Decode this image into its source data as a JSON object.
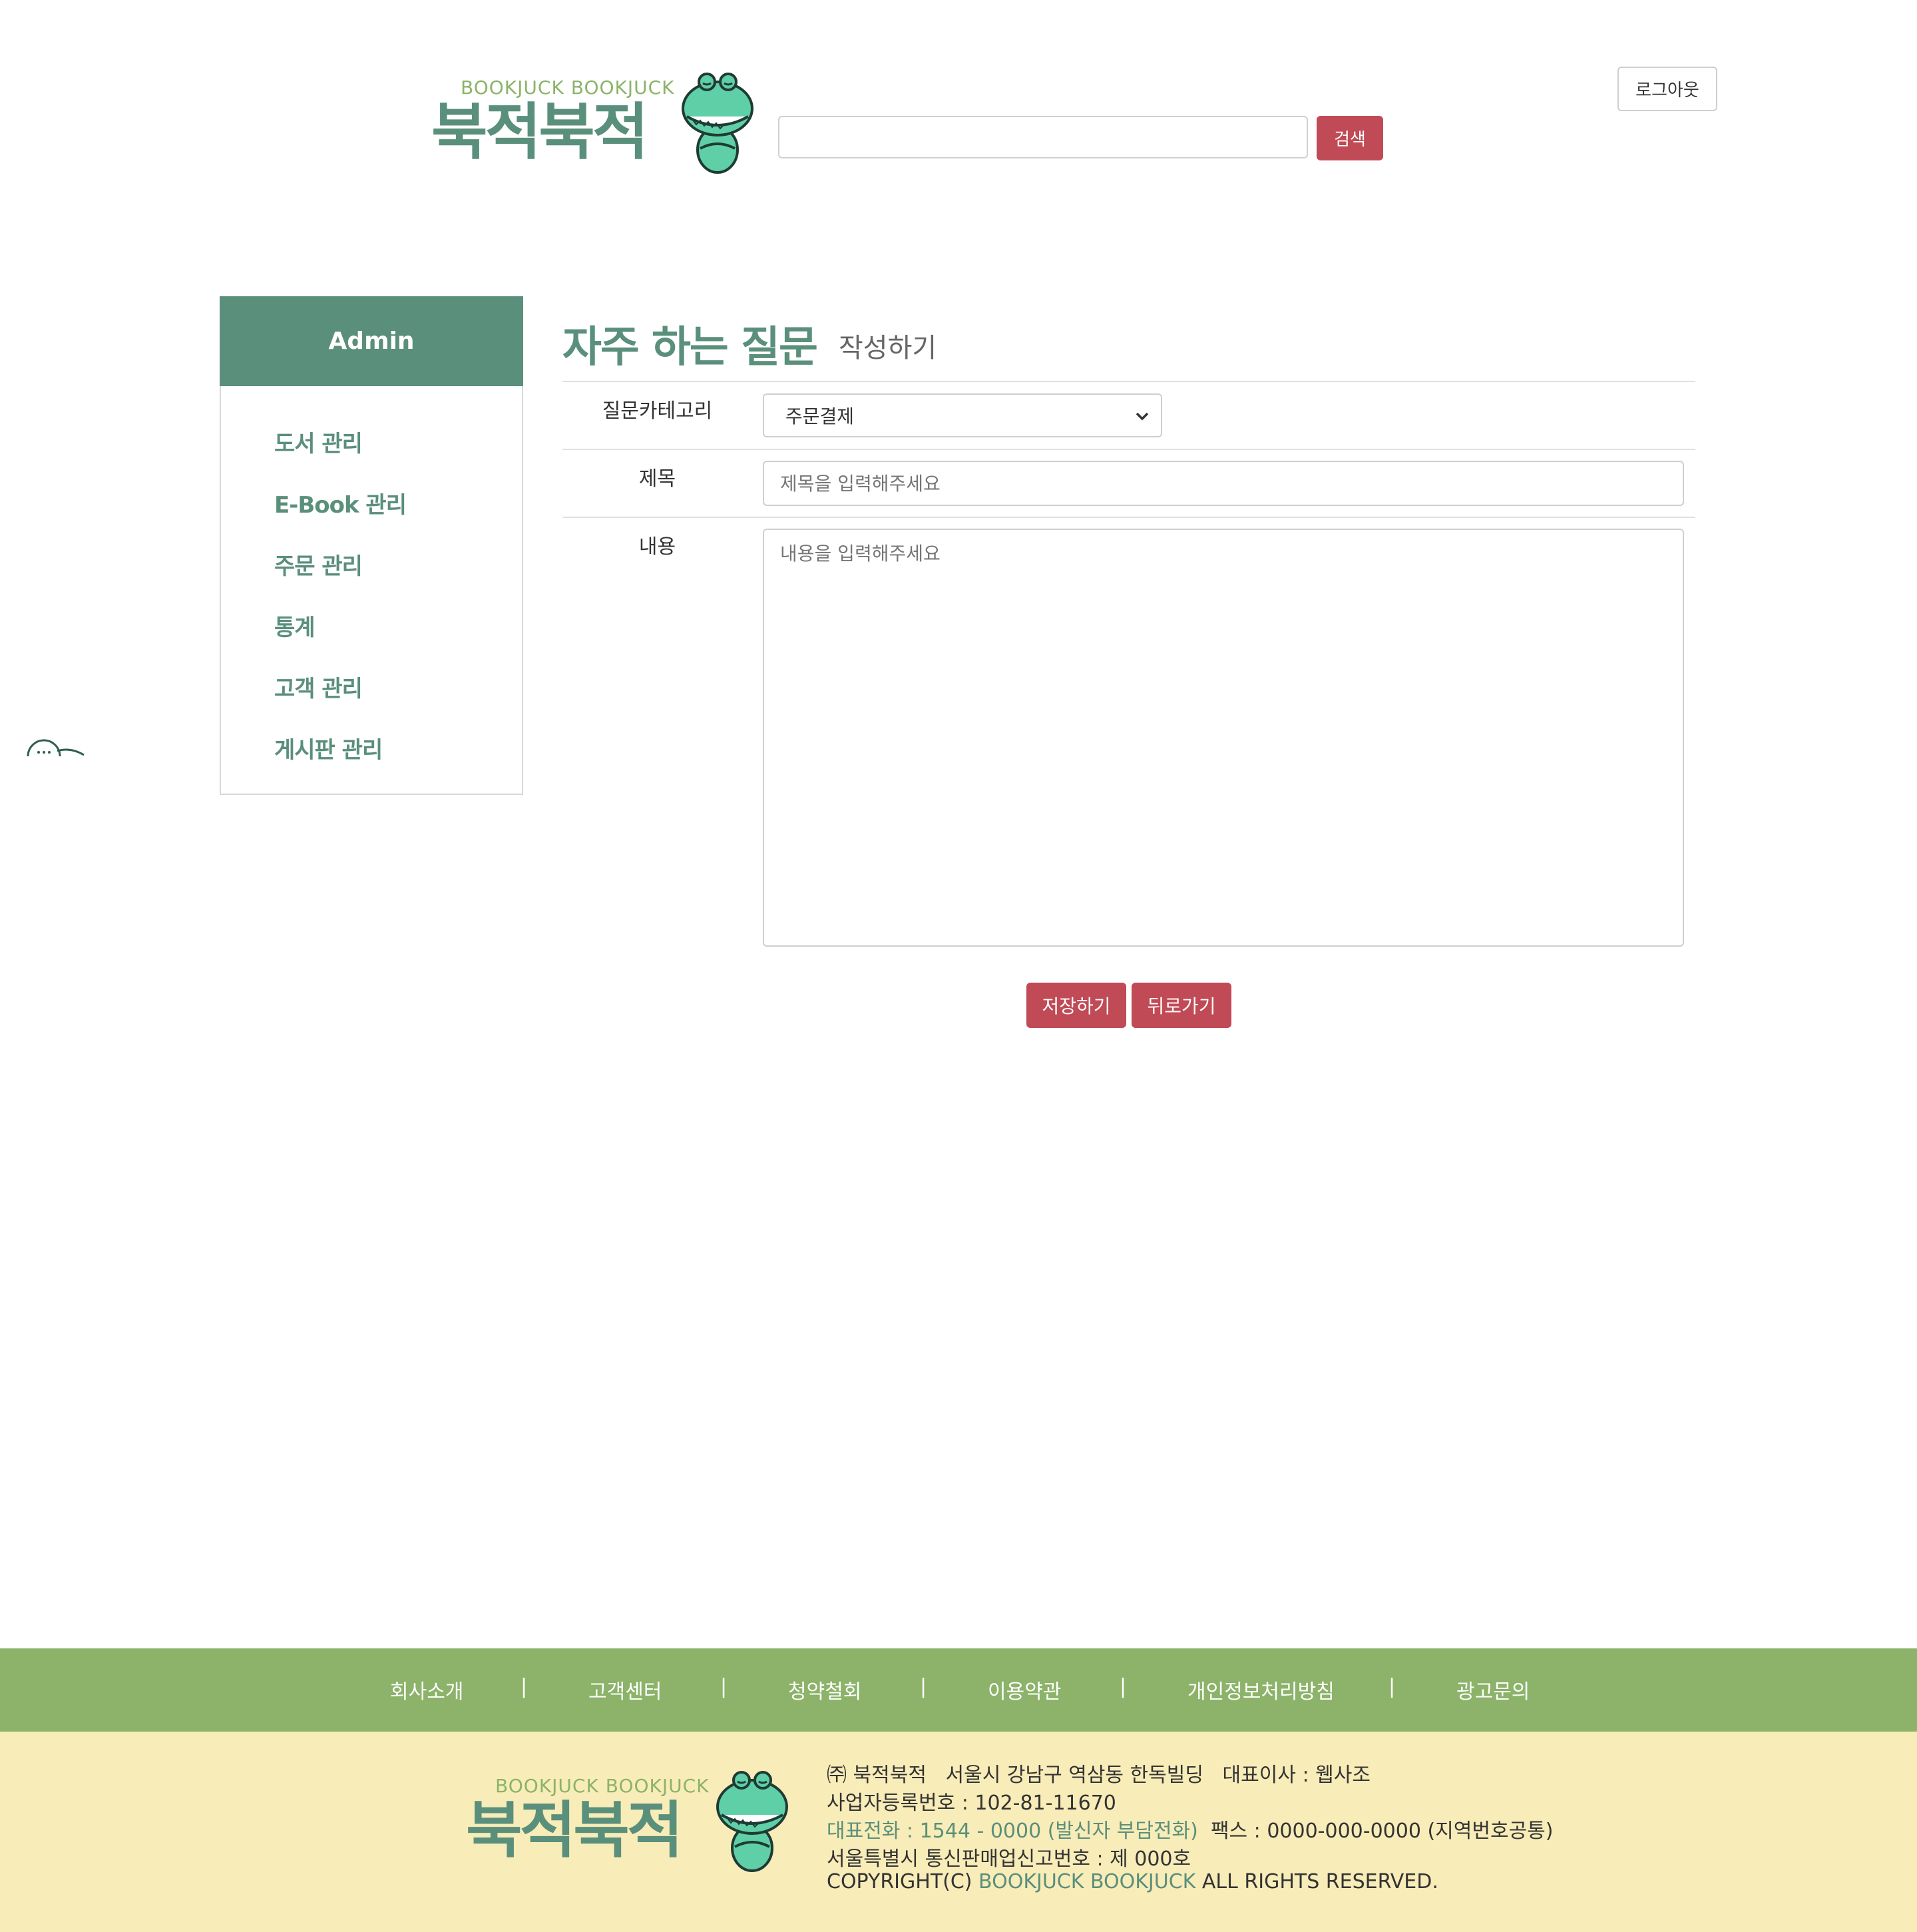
{
  "header": {
    "logo_sub": "BOOKJUCK BOOKJUCK",
    "logo_main": "북적북적",
    "search_value": "",
    "search_button": "검색",
    "logout_button": "로그아웃"
  },
  "sidebar": {
    "title": "Admin",
    "items": [
      {
        "label": "도서 관리"
      },
      {
        "label": "E-Book 관리"
      },
      {
        "label": "주문 관리"
      },
      {
        "label": "통계"
      },
      {
        "label": "고객 관리"
      },
      {
        "label": "게시판 관리"
      }
    ]
  },
  "main": {
    "title": "자주 하는 질문",
    "subtitle": "작성하기",
    "category_label": "질문카테고리",
    "category_selected": "주문결제",
    "title_label": "제목",
    "title_placeholder": "제목을 입력해주세요",
    "content_label": "내용",
    "content_placeholder": "내용을 입력해주세요",
    "save_button": "저장하기",
    "back_button": "뒤로가기"
  },
  "footer": {
    "links": [
      "회사소개",
      "고객센터",
      "청약철회",
      "이용약관",
      "개인정보처리방침",
      "광고문의"
    ],
    "separator": "|",
    "logo_sub": "BOOKJUCK BOOKJUCK",
    "logo_main": "북적북적",
    "company_line": "㈜ 북적북적   서울시 강남구 역삼동 한독빌딩   대표이사 : 웹사조",
    "business_no": "사업자등록번호 : 102-81-11670",
    "phone": "대표전화 : 1544 - 0000 (발신자 부담전화)",
    "fax": "팩스 : 0000-000-0000 (지역번호공통)",
    "mail_order": "서울특별시 통신판매업신고번호 : 제 000호",
    "copyright_prefix": "COPYRIGHT(C)",
    "copyright_brand": "BOOKJUCK BOOKJUCK",
    "copyright_suffix": "ALL RIGHTS RESERVED."
  },
  "colors": {
    "brand_green": "#5a8f7b",
    "light_green": "#8cb369",
    "button_red": "#c04a55",
    "footer_cream": "#f8ecb8"
  }
}
